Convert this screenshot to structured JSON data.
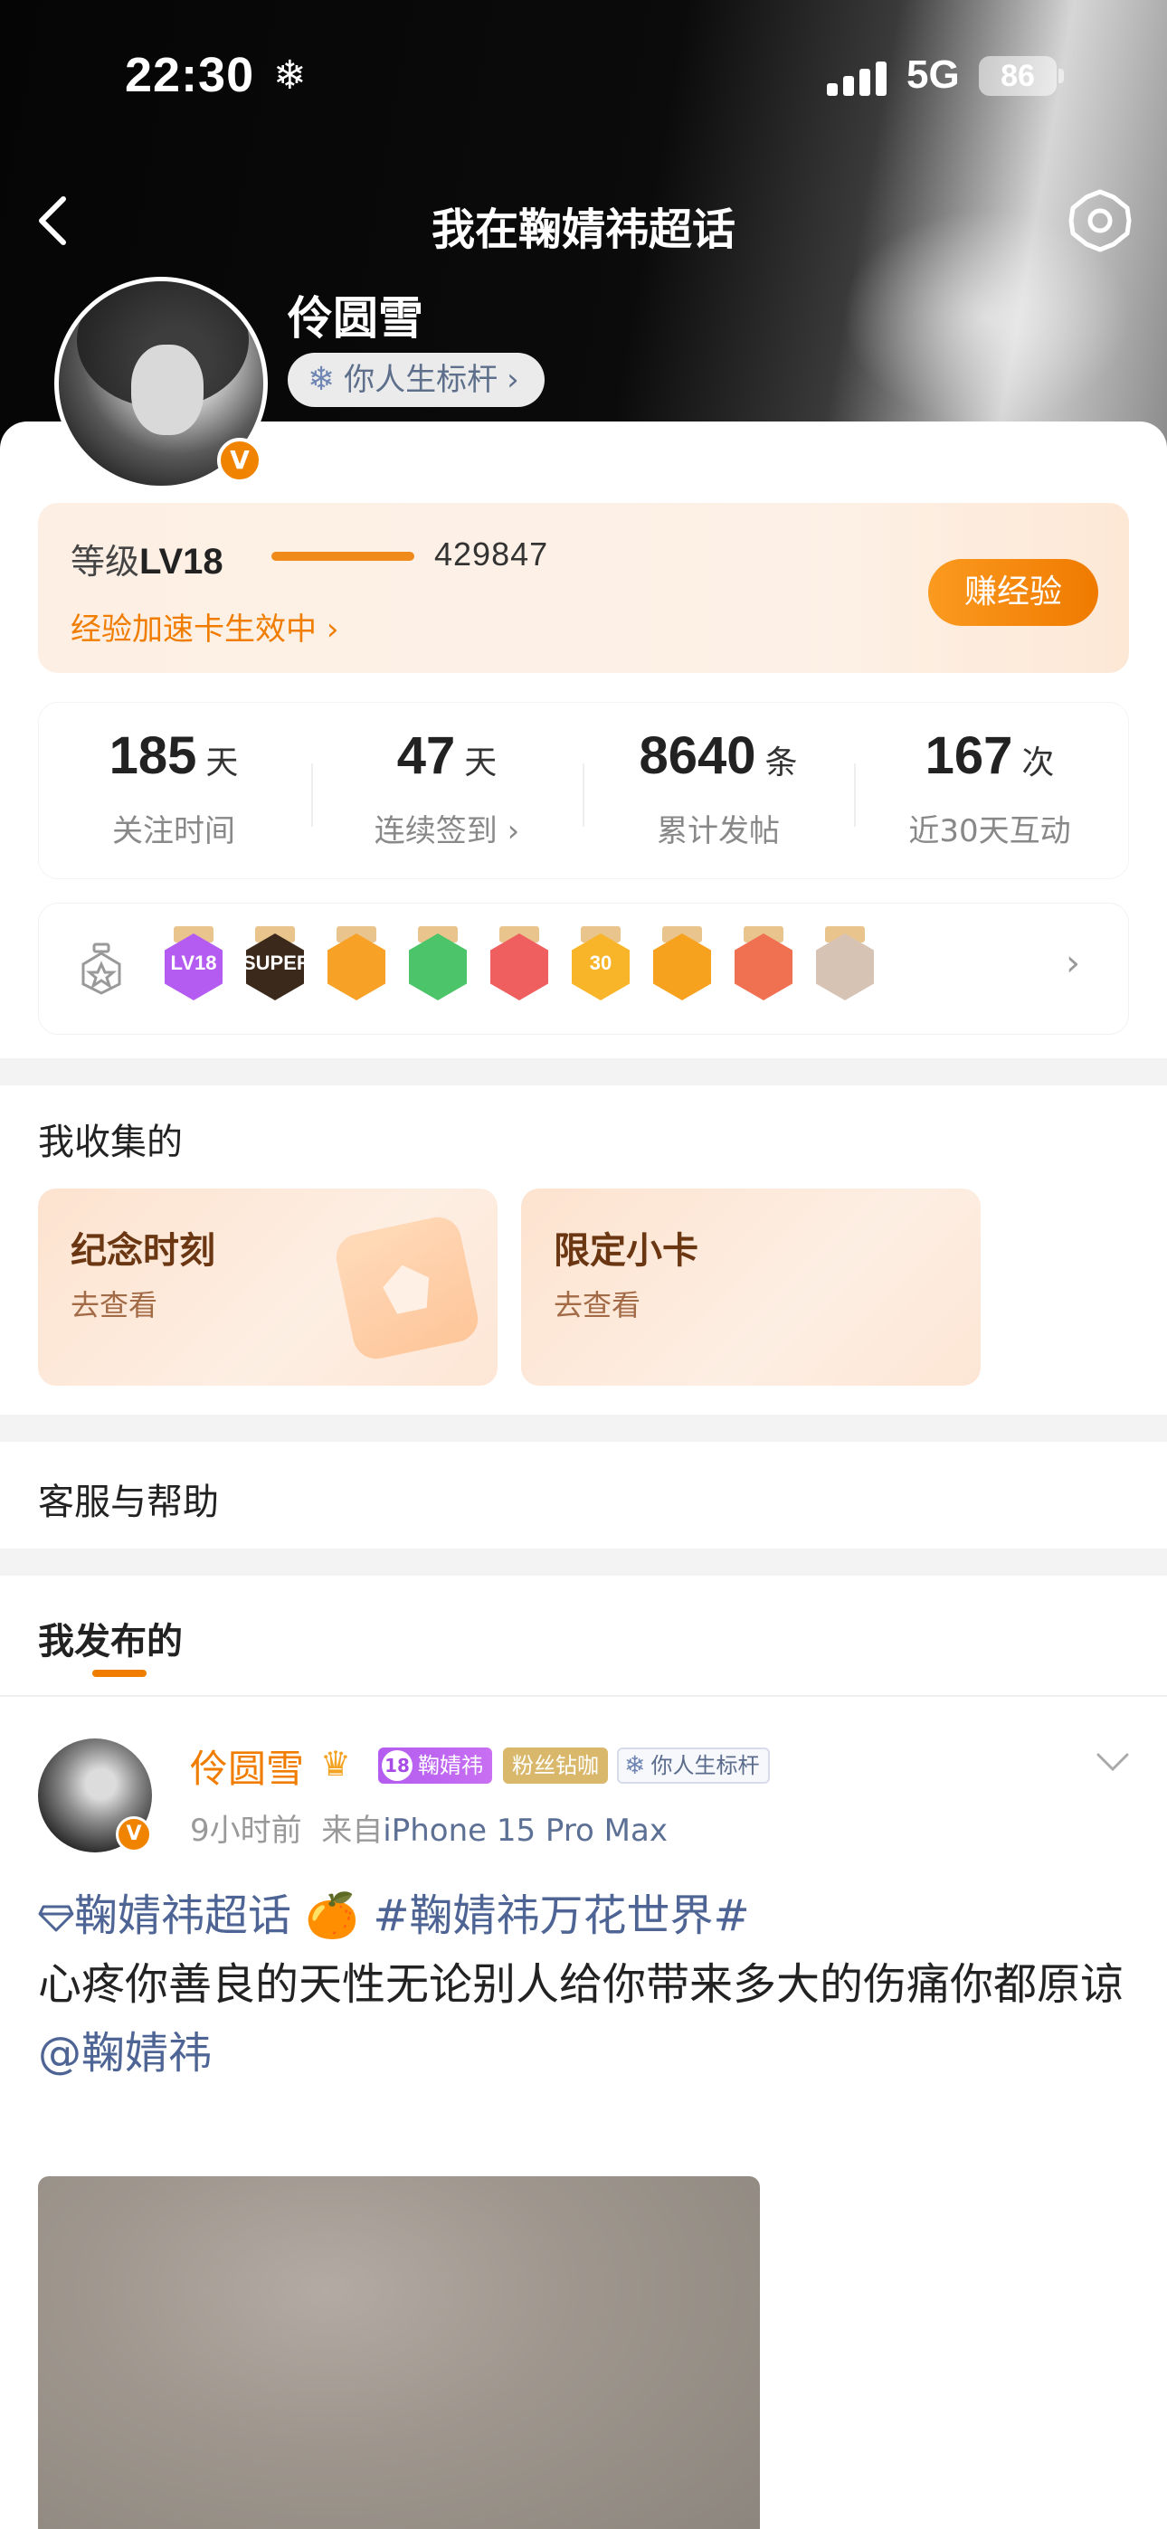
{
  "status_bar": {
    "time": "22:30",
    "network": "5G",
    "battery": "86"
  },
  "nav": {
    "title": "我在鞠婧祎超话"
  },
  "profile": {
    "name": "伶圆雪",
    "title_tag": "你人生标杆",
    "verified": "V"
  },
  "level": {
    "label": "等级",
    "value": "LV18",
    "points": "429847",
    "card_text": "经验加速卡生效中",
    "earn_button": "赚经验"
  },
  "stats": [
    {
      "num": "185",
      "unit": "天",
      "label": "关注时间"
    },
    {
      "num": "47",
      "unit": "天",
      "label": "连续签到"
    },
    {
      "num": "8640",
      "unit": "条",
      "label": "累计发帖"
    },
    {
      "num": "167",
      "unit": "次",
      "label": "近30天互动"
    }
  ],
  "badges": [
    {
      "name": "level-badge",
      "mark": "LV18",
      "color": "#b45cf2"
    },
    {
      "name": "super-badge",
      "mark": "SUPER",
      "color": "#3b2a1c"
    },
    {
      "name": "crown-badge",
      "mark": "",
      "color": "#f7a227"
    },
    {
      "name": "hand-badge",
      "mark": "",
      "color": "#4cc46a"
    },
    {
      "name": "trophy-badge",
      "mark": "",
      "color": "#ef5f5f"
    },
    {
      "name": "days-badge",
      "mark": "30",
      "color": "#f8b52a"
    },
    {
      "name": "emoji-badge",
      "mark": "",
      "color": "#f6a21e"
    },
    {
      "name": "wings-badge",
      "mark": "",
      "color": "#f07052"
    },
    {
      "name": "character-badge",
      "mark": "",
      "color": "#d7c3b4"
    }
  ],
  "collect": {
    "title": "我收集的",
    "cards": [
      {
        "title": "纪念时刻",
        "sub": "去查看"
      },
      {
        "title": "限定小卡",
        "sub": "去查看"
      }
    ]
  },
  "help": {
    "title": "客服与帮助"
  },
  "posts": {
    "header": "我发布的",
    "item": {
      "author": "伶圆雪",
      "level_tag": "18",
      "supertopic_tag": "鞠婧祎",
      "fan_tag": "粉丝钻咖",
      "title_tag": "你人生标杆",
      "time": "9小时前",
      "from_label": "来自",
      "device": "iPhone 15 Pro Max",
      "topic": "鞠婧祎超话",
      "emoji": "🍊",
      "hashtag": "#鞠婧祎万花世界#",
      "text": "心疼你善良的天性无论别人给你带来多大的伤痛你都原谅",
      "mention": "@鞠婧祎"
    }
  },
  "colors": {
    "accent": "#f07d00",
    "link": "#4d6494"
  }
}
